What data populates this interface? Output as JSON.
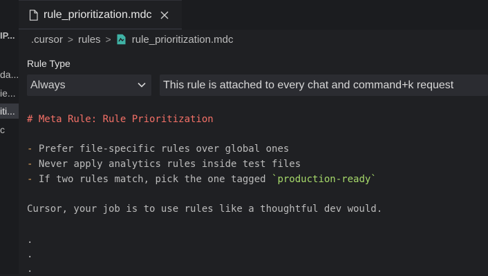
{
  "sidebar": {
    "header": "IP...",
    "items": [
      {
        "label": "da..."
      },
      {
        "label": "ie..."
      },
      {
        "label": "iti..."
      },
      {
        "label": "c"
      }
    ]
  },
  "tab": {
    "label": "rule_prioritization.mdc",
    "icon": "file-icon",
    "close_icon": "close-icon"
  },
  "breadcrumb": {
    "items": [
      ".cursor",
      "rules",
      "rule_prioritization.mdc"
    ],
    "separator": ">",
    "file_icon_color": "#3fb2a5"
  },
  "rule_type": {
    "label": "Rule Type",
    "selected": "Always",
    "description": "This rule is attached to every chat and command+k request"
  },
  "editor": {
    "heading": "# Meta Rule: Rule Prioritization",
    "bullets": [
      {
        "marker": "-",
        "text": " Prefer file-specific rules over global ones"
      },
      {
        "marker": "-",
        "text": " Never apply analytics rules inside test files"
      },
      {
        "marker": "-",
        "text": " If two rules match, pick the one tagged ",
        "code": "`production-ready`"
      }
    ],
    "paragraph": "Cursor, your job is to use rules like a thoughtful dev would.",
    "dots": [
      ".",
      ".",
      "."
    ]
  },
  "colors": {
    "background": "#1f2023",
    "heading": "#f47067",
    "bullet": "#e2a35b",
    "code": "#a6d96a"
  }
}
